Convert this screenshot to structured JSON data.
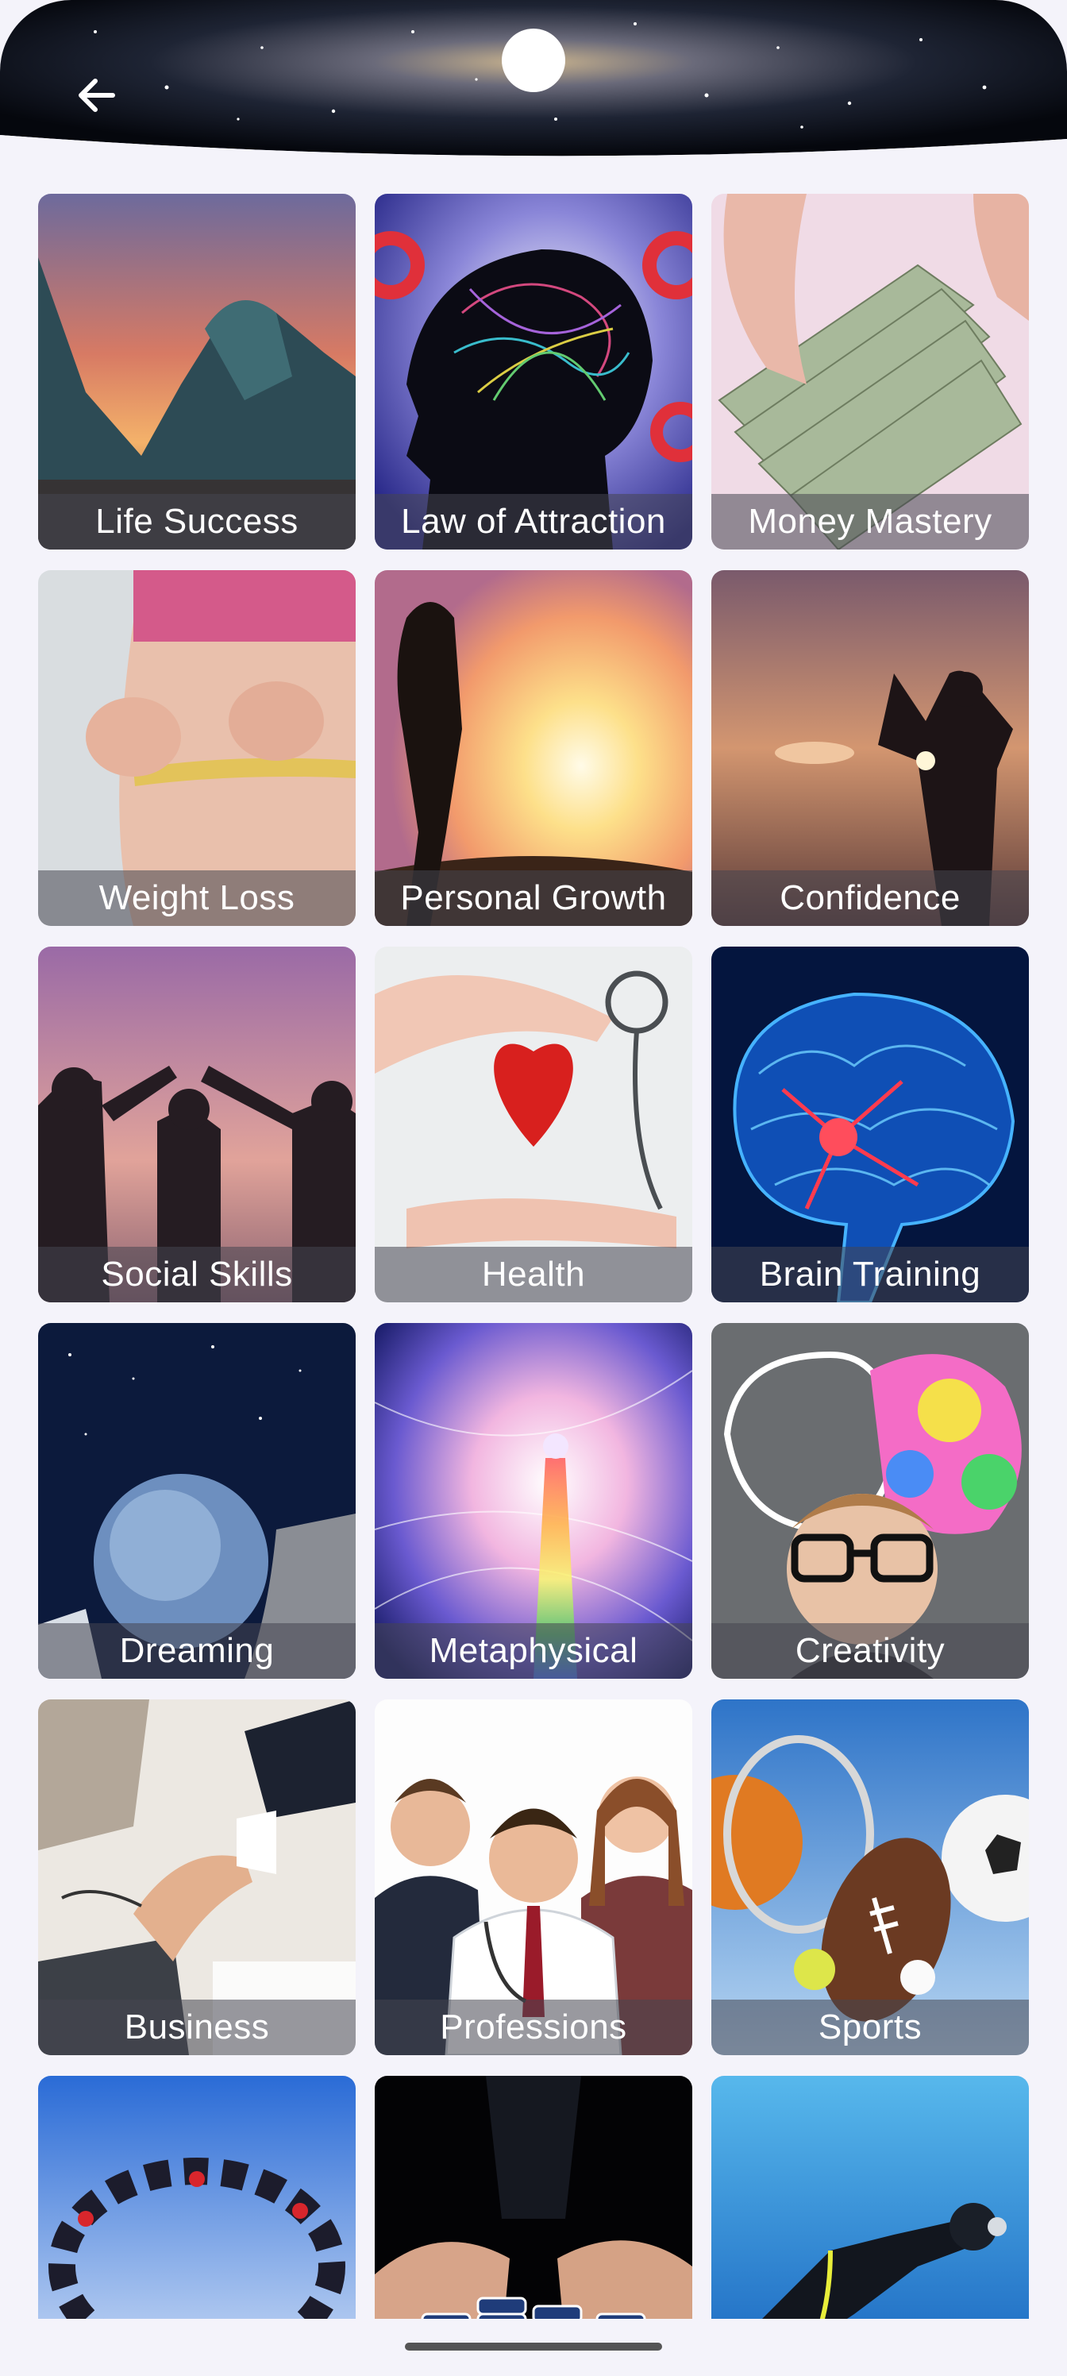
{
  "header": {
    "back_icon": "arrow-left-icon",
    "background": "galaxy-starfield"
  },
  "categories": [
    {
      "label": "Life Success",
      "image": "person-raising-arms-at-sunset"
    },
    {
      "label": "Law of Attraction",
      "image": "head-silhouette-with-neural-brain-and-magnets"
    },
    {
      "label": "Money Mastery",
      "image": "hands-holding-dollar-bills"
    },
    {
      "label": "Weight Loss",
      "image": "measuring-tape-around-waist"
    },
    {
      "label": "Personal Growth",
      "image": "woman-silhouette-against-sun"
    },
    {
      "label": "Confidence",
      "image": "woman-flexing-at-sunset"
    },
    {
      "label": "Social Skills",
      "image": "friends-holding-hands-silhouette"
    },
    {
      "label": "Health",
      "image": "red-heart-between-hands-and-stethoscope"
    },
    {
      "label": "Brain Training",
      "image": "glowing-blue-brain"
    },
    {
      "label": "Dreaming",
      "image": "hands-on-crystal-ball-under-stars"
    },
    {
      "label": "Metaphysical",
      "image": "person-in-light-rays"
    },
    {
      "label": "Creativity",
      "image": "child-with-glasses-and-colorful-brain"
    },
    {
      "label": "Business",
      "image": "business-handshake"
    },
    {
      "label": "Professions",
      "image": "group-of-professionals"
    },
    {
      "label": "Sports",
      "image": "sports-balls"
    },
    {
      "label": "",
      "image": "skydivers-formation"
    },
    {
      "label": "",
      "image": "hands-with-poker-chips"
    },
    {
      "label": "",
      "image": "scuba-diver-underwater"
    }
  ]
}
